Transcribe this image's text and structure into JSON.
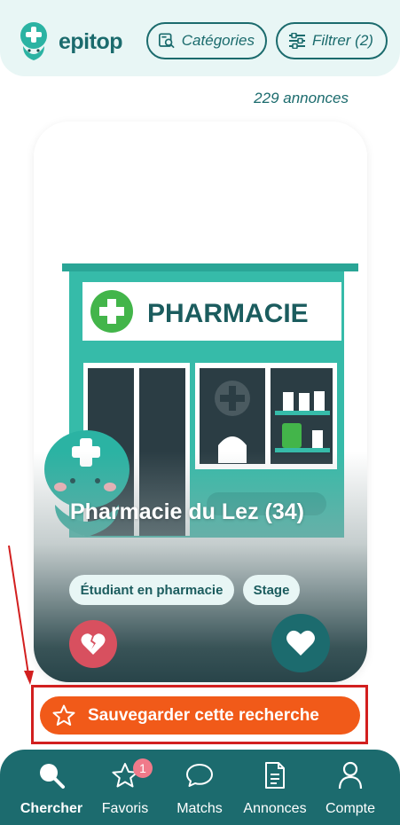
{
  "app": {
    "name": "epitop"
  },
  "header": {
    "categories_label": "Catégories",
    "filter_label": "Filtrer (2)"
  },
  "results": {
    "count_label": "229 annonces"
  },
  "card": {
    "sign_text": "PHARMACIE",
    "title": "Pharmacie du Lez (34)",
    "tags": [
      "Étudiant en pharmacie",
      "Stage"
    ],
    "dislike_icon": "broken-heart-icon",
    "like_icon": "heart-icon"
  },
  "save_search": {
    "label": "Sauvegarder cette recherche",
    "icon": "star-icon"
  },
  "bottom_nav": {
    "items": [
      {
        "label": "Chercher",
        "icon": "search-icon",
        "active": true
      },
      {
        "label": "Favoris",
        "icon": "star-icon",
        "badge": "1"
      },
      {
        "label": "Matchs",
        "icon": "chat-bubble-icon"
      },
      {
        "label": "Annonces",
        "icon": "document-icon"
      },
      {
        "label": "Compte",
        "icon": "user-icon"
      }
    ]
  },
  "colors": {
    "primary": "#1c6b6e",
    "header_bg": "#e8f6f5",
    "accent_orange": "#f15a19",
    "dislike_red": "#d8505f",
    "highlight_red": "#d21f1f",
    "badge_pink": "#f07a8a"
  }
}
